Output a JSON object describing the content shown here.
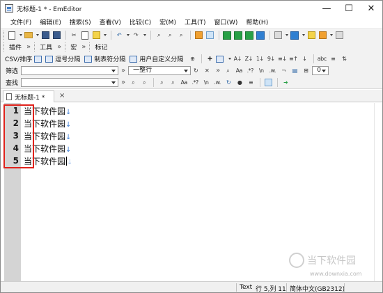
{
  "window": {
    "title": "无标题-1 * - EmEditor",
    "minimize": "—",
    "maximize": "☐",
    "close": "✕"
  },
  "menu": [
    "文件(F)",
    "编辑(E)",
    "搜索(S)",
    "查看(V)",
    "比较(C)",
    "宏(M)",
    "工具(T)",
    "窗口(W)",
    "帮助(H)"
  ],
  "toolbar2": {
    "plugins": "插件",
    "tools": "工具",
    "macros": "宏",
    "markers": "标记"
  },
  "csvbar": {
    "csv_sort": "CSV/排序",
    "comma": "逗号分隔",
    "tab": "制表符分隔",
    "user_defined": "用户自定义分隔"
  },
  "filterbar": {
    "label": "筛选",
    "whole_line": "一整行"
  },
  "searchbar": {
    "label": "查找"
  },
  "tab": {
    "label": "无标题-1 *",
    "close": "×"
  },
  "editor": {
    "lines": [
      {
        "num": "1",
        "text": "当下软件园"
      },
      {
        "num": "2",
        "text": "当下软件园"
      },
      {
        "num": "3",
        "text": "当下软件园"
      },
      {
        "num": "4",
        "text": "当下软件园"
      },
      {
        "num": "5",
        "text": "当下软件园"
      }
    ],
    "eol_mark": "↓"
  },
  "status": {
    "mode": "Text",
    "position": "行 5,列 11",
    "encoding": "简体中文(GB2312)"
  },
  "watermark": {
    "name": "当下软件园",
    "url": "www.downxia.com"
  },
  "colors": {
    "highlight_box": "#e0221b",
    "eol_arrow": "#3f7fd6",
    "gutter": "#d4d4d4"
  }
}
